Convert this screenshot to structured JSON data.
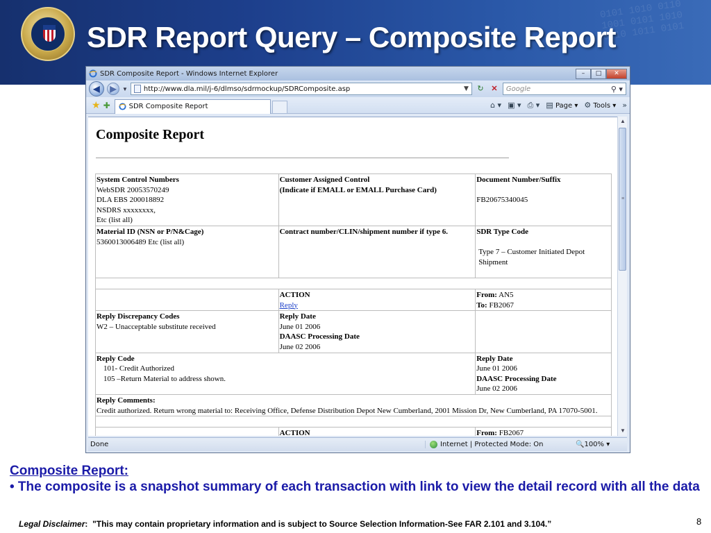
{
  "slide": {
    "title": "SDR Report Query – Composite Report",
    "caption_heading": "Composite Report:",
    "caption_body": "• The composite is a snapshot summary of each transaction with link to view the detail record with all the data",
    "disclaimer_label": "Legal Disclaimer",
    "disclaimer_colon": ":",
    "disclaimer_text": "\"This may contain proprietary information and is subject to Source Selection Information-See FAR 2.101 and 3.104.”",
    "page_number": "8"
  },
  "browser": {
    "window_title": "SDR Composite Report - Windows Internet Explorer",
    "minimize": "–",
    "maximize": "□",
    "close": "✕",
    "url": "http://www.dla.mil/j-6/dlmso/sdrmockup/SDRComposite.asp",
    "search_placeholder": "Google",
    "tab_label": "SDR Composite Report",
    "cmd_page": "Page",
    "cmd_tools": "Tools",
    "status_text": "Done",
    "zone_text": "Internet | Protected Mode: On",
    "zoom": "100%",
    "icons": {
      "back": "back-arrow-icon",
      "forward": "forward-arrow-icon",
      "refresh": "refresh-icon",
      "stop": "stop-icon",
      "search": "search-icon",
      "favorites": "star-icon",
      "add_favorite": "add-favorite-icon",
      "home": "home-icon",
      "feeds": "feeds-icon",
      "print": "print-icon",
      "page": "page-icon",
      "tools": "gear-icon",
      "globe": "globe-icon"
    }
  },
  "report": {
    "heading": "Composite Report",
    "row1": {
      "col1_head": "System Control Numbers",
      "col1_lines": [
        "WebSDR 20053570249",
        "DLA EBS 200018892",
        "NSDRS xxxxxxxx,",
        "Etc (list all)"
      ],
      "col2_head": "Customer Assigned Control",
      "col2_sub": "(Indicate if EMALL or EMALL Purchase Card)",
      "col3_head": "Document Number/Suffix",
      "col3_value": "FB20675340045"
    },
    "row2": {
      "col1_head": "Material ID (NSN or P/N&Cage)",
      "col1_value": "5360013006489 Etc (list all)",
      "col2_head": "Contract number/CLIN/shipment number if type 6.",
      "col3_head": "SDR Type Code",
      "col3_value": "Type 7 – Customer Initiated Depot Shipment"
    },
    "action1": {
      "label": "ACTION",
      "link": "Reply",
      "from_label": "From:",
      "from_value": "AN5",
      "to_label": "To:",
      "to_value": "FB2067"
    },
    "reply1": {
      "codes_head": "Reply Discrepancy Codes",
      "codes_value": "W2 – Unacceptable substitute received",
      "date_head": "Reply Date",
      "date_value": "June 01 2006",
      "daasc_head": "DAASC Processing Date",
      "daasc_value": "June 02 2006"
    },
    "reply2": {
      "code_head": "Reply Code",
      "code_lines": [
        "101- Credit Authorized",
        "105 –Return Material to address shown."
      ],
      "date_head": "Reply Date",
      "date_value": "June 01 2006",
      "daasc_head": "DAASC Processing Date",
      "daasc_value": "June 02 2006"
    },
    "comments": {
      "head": "Reply Comments:",
      "text": "Credit authorized. Return wrong material to: Receiving Office, Defense Distribution Depot New Cumberland, 2001 Mission Dr, New Cumberland, PA 17070-5001."
    },
    "action2": {
      "label": "ACTION",
      "from_label": "From:",
      "from_value": "FB2067"
    }
  }
}
